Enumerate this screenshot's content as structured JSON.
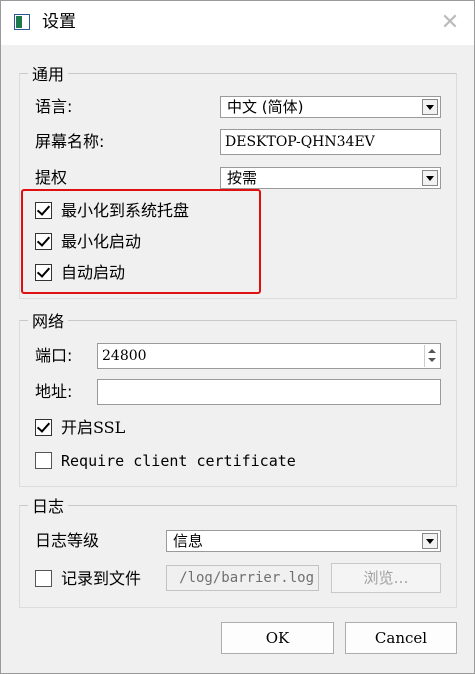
{
  "window": {
    "title": "设置",
    "close_symbol": "✕"
  },
  "general": {
    "legend": "通用",
    "language_label": "语言:",
    "language_value": "中文 (简体)",
    "screen_name_label": "屏幕名称:",
    "screen_name_value": "DESKTOP-QHN34EV",
    "elevate_label": "提权",
    "elevate_value": "按需",
    "minimize_tray_label": "最小化到系统托盘",
    "minimize_tray_checked": true,
    "start_minimized_label": "最小化启动",
    "start_minimized_checked": true,
    "autostart_label": "自动启动",
    "autostart_checked": true
  },
  "network": {
    "legend": "网络",
    "port_label": "端口:",
    "port_value": "24800",
    "address_label": "地址:",
    "address_value": "",
    "ssl_label": "开启SSL",
    "ssl_checked": true,
    "client_cert_label": "Require client certificate",
    "client_cert_checked": false
  },
  "log": {
    "legend": "日志",
    "level_label": "日志等级",
    "level_value": "信息",
    "log_to_file_label": "记录到文件",
    "log_to_file_checked": false,
    "log_path_value": "/log/barrier.log",
    "browse_label": "浏览…"
  },
  "footer": {
    "ok_label": "OK",
    "cancel_label": "Cancel"
  },
  "colors": {
    "highlight": "#e01010"
  }
}
